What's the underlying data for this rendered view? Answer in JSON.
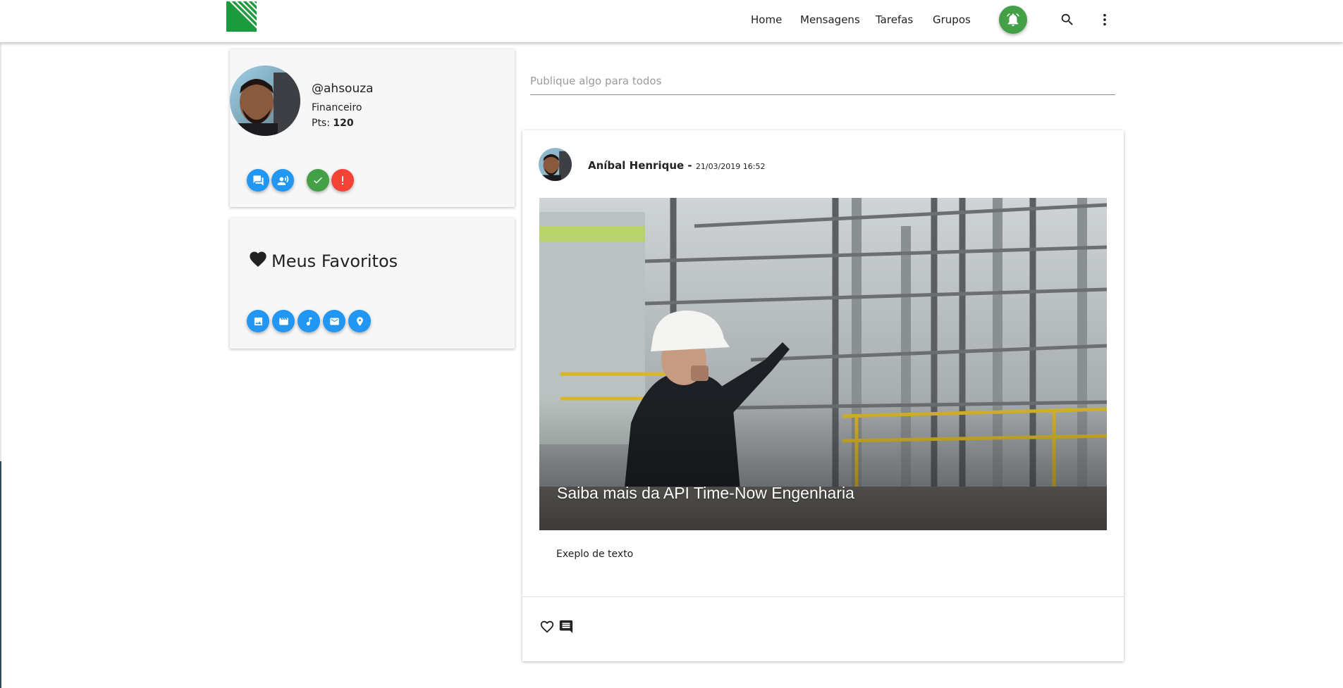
{
  "nav": {
    "items": [
      {
        "label": "Home"
      },
      {
        "label": "Mensagens"
      },
      {
        "label": "Tarefas"
      },
      {
        "label": "Grupos"
      }
    ],
    "notification_icon": "bell-icon",
    "search_icon": "search-icon",
    "menu_icon": "more-vert-icon"
  },
  "profile": {
    "username": "@ahsouza",
    "department": "Financeiro",
    "points_label": "Pts:",
    "points_value": "120",
    "action_icons": [
      "chat-icon",
      "record-voice-icon",
      "check-icon",
      "alert-icon"
    ]
  },
  "favorites": {
    "title": "Meus Favoritos",
    "icons": [
      "image-icon",
      "movie-icon",
      "music-icon",
      "mail-icon",
      "location-icon"
    ]
  },
  "composer": {
    "placeholder": "Publique algo para todos"
  },
  "post": {
    "author": "Aníbal Henrique",
    "separator": " - ",
    "date": "21/03/2019 16:52",
    "image_caption": "Saiba mais da API Time-Now Engenharia",
    "text": "Exeplo de texto"
  },
  "colors": {
    "brand_green": "#1b9a3e",
    "accent_blue": "#2196f3",
    "success_green": "#43a047",
    "alert_red": "#f44336"
  }
}
